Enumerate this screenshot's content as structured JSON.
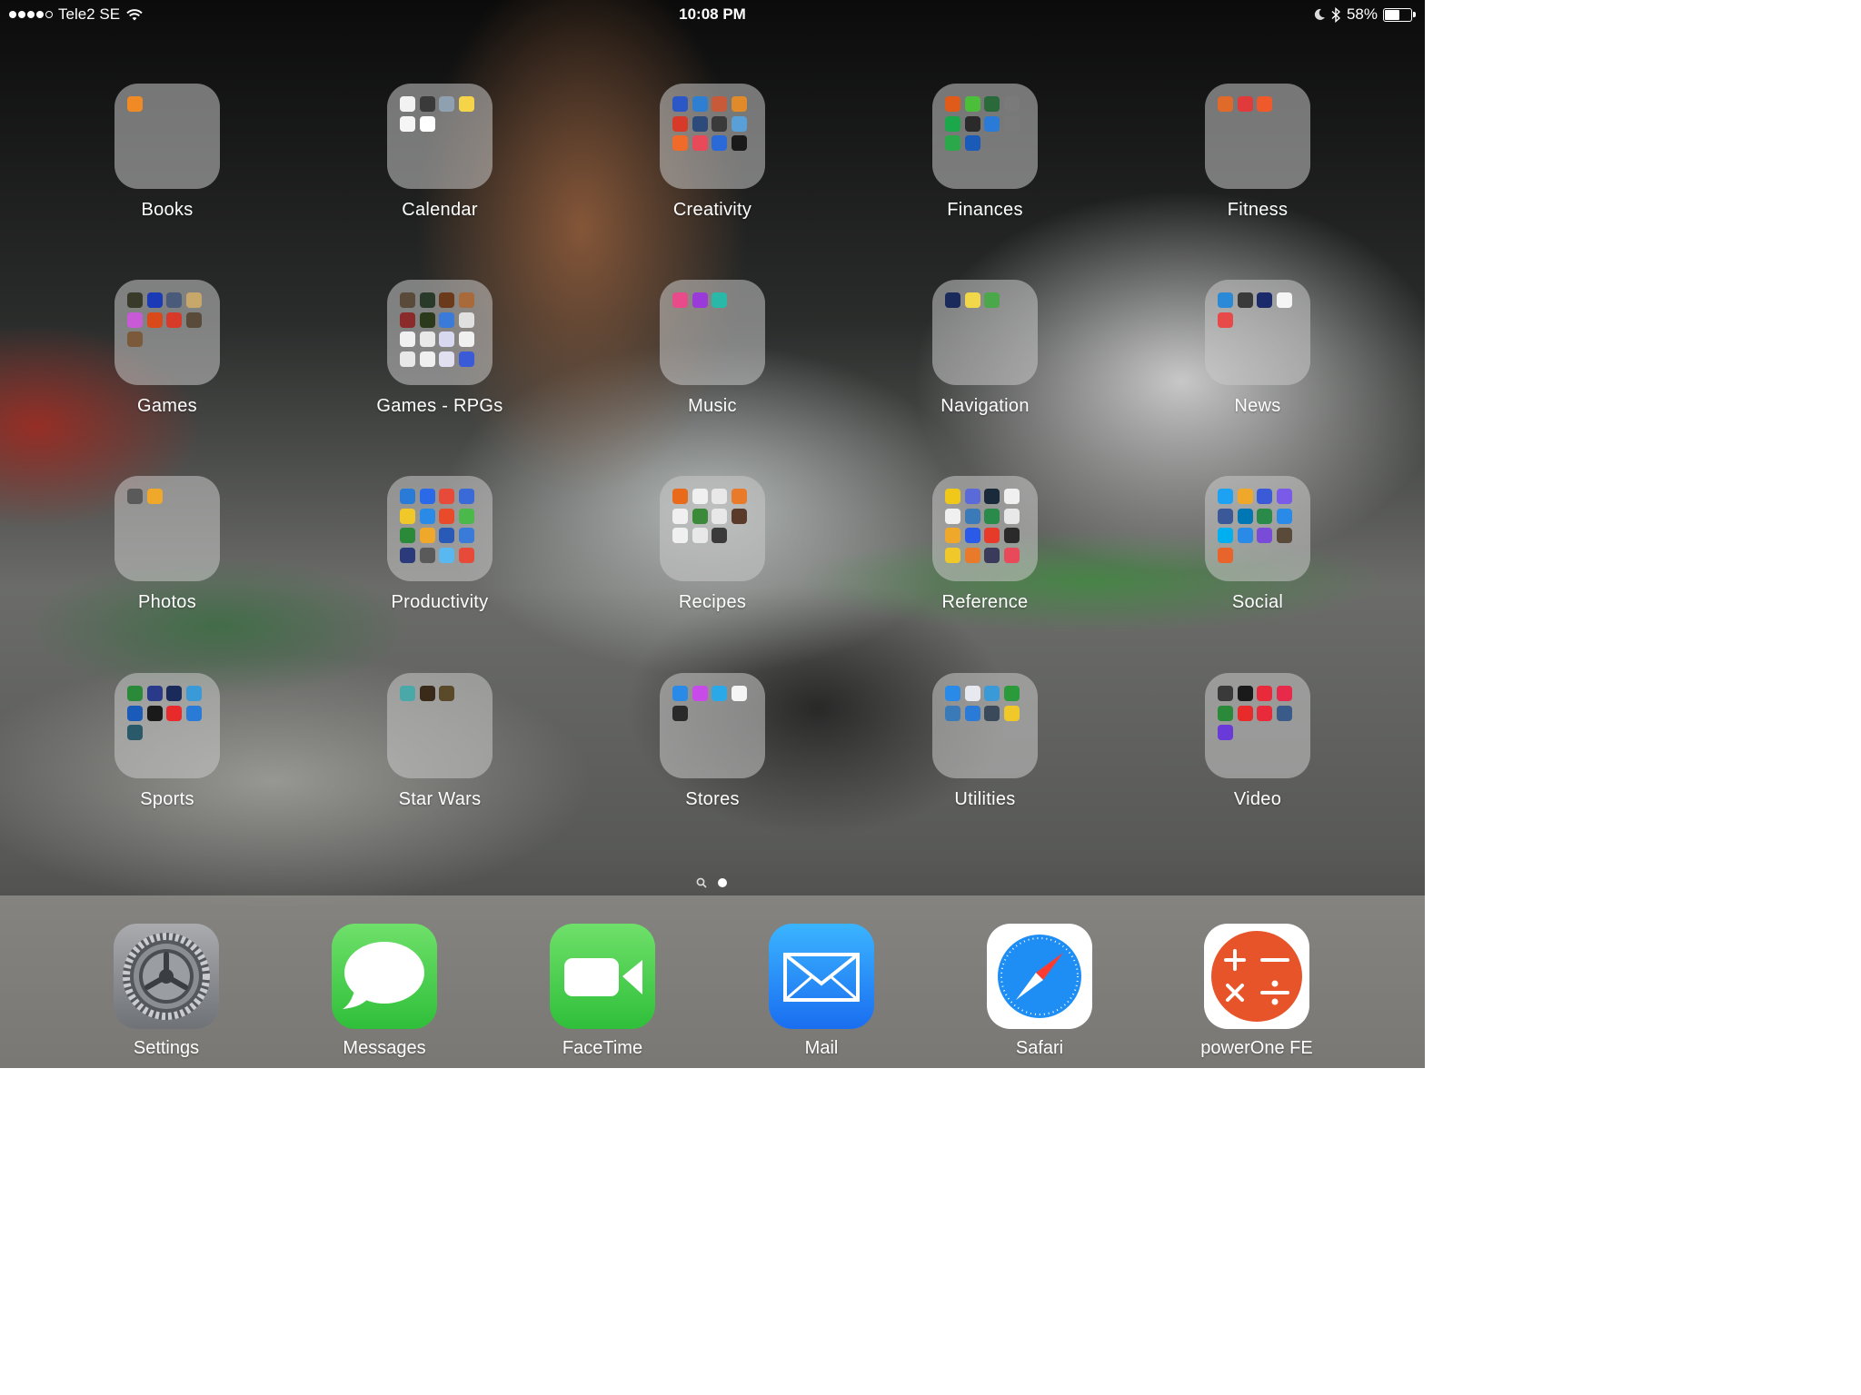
{
  "status": {
    "carrier": "Tele2 SE",
    "time": "10:08 PM",
    "battery": "58%",
    "battery_level": 0.58,
    "signal_bars": 4,
    "signal_total": 5
  },
  "folders": [
    {
      "label": "Books",
      "icons": [
        "#f08a24"
      ]
    },
    {
      "label": "Calendar",
      "icons": [
        "#f2f2f2",
        "#3a3a3a",
        "#8fa0b0",
        "#f6d44a",
        "#f5f5f5",
        "#ffffff"
      ]
    },
    {
      "label": "Creativity",
      "icons": [
        "#2b57c7",
        "#2e7fd1",
        "#c85a3a",
        "#e08a2a",
        "#d83a2a",
        "#2c4a7a",
        "#3a3a3a",
        "#5aa0d8",
        "#f06a2a",
        "#e84a5a",
        "#2a6ad8",
        "#1a1a1a"
      ]
    },
    {
      "label": "Finances",
      "icons": [
        "#e05a1a",
        "#4cbf3a",
        "#2a6a3a",
        "#7a7a7a",
        "#1aa84a",
        "#2a2a2a",
        "#2a7ad8",
        "#7a7a7a",
        "#2aa84a",
        "#1a5ab8"
      ]
    },
    {
      "label": "Fitness",
      "icons": [
        "#e06a2a",
        "#e03a3a",
        "#f05a2a"
      ]
    },
    {
      "label": "Games",
      "icons": [
        "#3a3a2a",
        "#1a3ab8",
        "#4a5a7a",
        "#c8a86a",
        "#c85ad8",
        "#d84a1a",
        "#d83a2a",
        "#5a4a3a",
        "#7a5a3a"
      ]
    },
    {
      "label": "Games - RPGs",
      "icons": [
        "#5a4a3a",
        "#2a3a2a",
        "#6a3a1a",
        "#a86a3a",
        "#8a2a2a",
        "#2a3a1a",
        "#3a7ad8",
        "#e0e0e0",
        "#f0f0f0",
        "#e8e8e8",
        "#d8d8f0",
        "#f0f0f0",
        "#e8e8e8",
        "#f0f0f0",
        "#e0e0f0",
        "#3a5ad8"
      ]
    },
    {
      "label": "Music",
      "icons": [
        "#e84a8a",
        "#9a3ad8",
        "#2ab8a8"
      ]
    },
    {
      "label": "Navigation",
      "icons": [
        "#1a2a5a",
        "#f0d84a",
        "#4aa84a"
      ]
    },
    {
      "label": "News",
      "icons": [
        "#2a8ad8",
        "#3a3a3a",
        "#1a2a6a",
        "#f5f5f5",
        "#e84a4a"
      ]
    },
    {
      "label": "Photos",
      "icons": [
        "#5a5a5a",
        "#f0a82a"
      ]
    },
    {
      "label": "Productivity",
      "icons": [
        "#2a7ad8",
        "#2a6ae8",
        "#e84a3a",
        "#3a6ad8",
        "#f0c82a",
        "#2a8ae8",
        "#e84a2a",
        "#4ab84a",
        "#2a8a3a",
        "#f0a82a",
        "#2a5ab8",
        "#3a7ad8",
        "#2a3a7a",
        "#5a5a5a",
        "#5ab8f0",
        "#e84a3a"
      ]
    },
    {
      "label": "Recipes",
      "icons": [
        "#e86a1a",
        "#f0f0f0",
        "#e8e8e8",
        "#e87a2a",
        "#f0f0f0",
        "#3a8a3a",
        "#e8e8e8",
        "#5a3a2a",
        "#f0f0f0",
        "#e8e8e8",
        "#3a3a3a"
      ]
    },
    {
      "label": "Reference",
      "icons": [
        "#f0c81a",
        "#5a6ad8",
        "#1a2a3a",
        "#f0f0f0",
        "#f0f0f0",
        "#3a7ab8",
        "#2a8a4a",
        "#e8e8e8",
        "#f0a82a",
        "#2a5ae8",
        "#e83a2a",
        "#2a2a2a",
        "#f0c82a",
        "#e87a2a",
        "#3a3a5a",
        "#e84a5a"
      ]
    },
    {
      "label": "Social",
      "icons": [
        "#1da1f2",
        "#f0a82a",
        "#3a5ad8",
        "#7a5ae8",
        "#3b5998",
        "#0077b5",
        "#2a8a4a",
        "#2a8ae8",
        "#00aff0",
        "#2a8ae8",
        "#7a4ad8",
        "#5a4a3a",
        "#e8642a"
      ]
    },
    {
      "label": "Sports",
      "icons": [
        "#2a8a3a",
        "#2a3a8a",
        "#1a2a5a",
        "#3a9ad8",
        "#1a5ab8",
        "#1a1a1a",
        "#e82a2a",
        "#2a7ad8",
        "#2a5a6a"
      ]
    },
    {
      "label": "Star Wars",
      "icons": [
        "#4aa8a8",
        "#3a2a1a",
        "#5a4a2a"
      ]
    },
    {
      "label": "Stores",
      "icons": [
        "#2a8ae8",
        "#c84ae8",
        "#2aa8e8",
        "#f5f5f5",
        "#2a2a2a"
      ]
    },
    {
      "label": "Utilities",
      "icons": [
        "#2a8ae8",
        "#e8e8f0",
        "#3a9ad8",
        "#2a9a3a",
        "#3a7ab8",
        "#2a7ad8",
        "#3a4a5a",
        "#f0c82a"
      ]
    },
    {
      "label": "Video",
      "icons": [
        "#3a3a3a",
        "#1a1a1a",
        "#e82a3a",
        "#e82a4a",
        "#2a8a3a",
        "#e82a2a",
        "#e82a3a",
        "#3a5a8a",
        "#6a3ad8"
      ]
    }
  ],
  "dock": [
    {
      "label": "Settings",
      "icon": "settings-gear-icon"
    },
    {
      "label": "Messages",
      "icon": "speech-bubble-icon"
    },
    {
      "label": "FaceTime",
      "icon": "video-camera-icon"
    },
    {
      "label": "Mail",
      "icon": "envelope-icon"
    },
    {
      "label": "Safari",
      "icon": "compass-icon"
    },
    {
      "label": "powerOne FE",
      "icon": "calculator-symbols-icon"
    }
  ],
  "page_indicator": {
    "pages": 2,
    "current": 2
  }
}
